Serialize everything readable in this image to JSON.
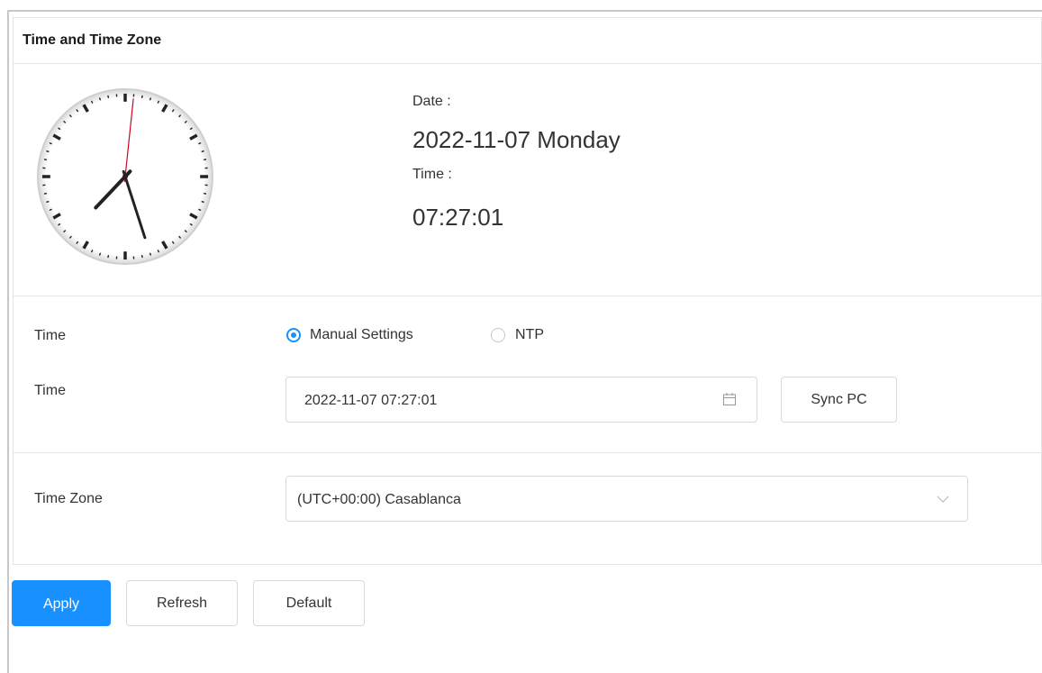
{
  "panel": {
    "title": "Time and Time Zone"
  },
  "clock_face": {
    "date_label": "Date :",
    "date_value": "2022-11-07 Monday",
    "time_label": "Time :",
    "time_value": "07:27:01"
  },
  "form": {
    "time_mode_label": "Time",
    "options": [
      {
        "label": "Manual Settings",
        "selected": true
      },
      {
        "label": "NTP",
        "selected": false
      }
    ],
    "time_label": "Time",
    "time_value": "2022-11-07 07:27:01",
    "calendar_icon": "calendar-icon",
    "sync_pc_label": "Sync PC",
    "timezone_label": "Time Zone",
    "timezone_value": "(UTC+00:00) Casablanca",
    "dropdown_icon": "chevron-down-icon"
  },
  "actions": {
    "apply_label": "Apply",
    "refresh_label": "Refresh",
    "default_label": "Default"
  },
  "colors": {
    "accent": "#1890ff",
    "second_hand": "#d0021b",
    "hand": "#222222"
  }
}
